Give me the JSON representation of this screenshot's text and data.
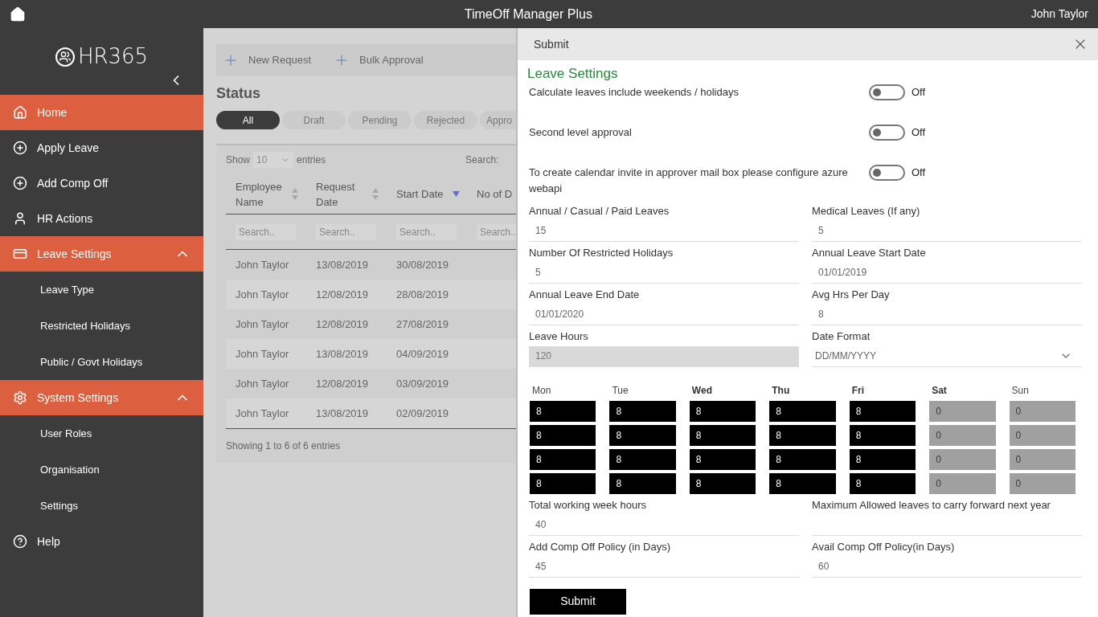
{
  "app_bar": {
    "title": "TimeOff Manager Plus",
    "user": "John Taylor"
  },
  "sidebar": {
    "logo": "HR365",
    "items": [
      {
        "kind": "link",
        "label": "Home",
        "selected": true
      },
      {
        "kind": "link",
        "label": "Apply Leave",
        "selected": false
      },
      {
        "kind": "link",
        "label": "Add Comp Off",
        "selected": false
      },
      {
        "kind": "link",
        "label": "HR Actions",
        "selected": false
      },
      {
        "kind": "group",
        "label": "Leave Settings",
        "expanded": true,
        "children": [
          {
            "label": "Leave Type"
          },
          {
            "label": "Restricted Holidays"
          },
          {
            "label": "Public / Govt Holidays"
          }
        ]
      },
      {
        "kind": "group",
        "label": "System Settings",
        "expanded": true,
        "children": [
          {
            "label": "User Roles"
          },
          {
            "label": "Organisation"
          },
          {
            "label": "Settings"
          }
        ]
      },
      {
        "kind": "link",
        "label": "Help",
        "selected": false
      }
    ]
  },
  "toolbar": [
    "New Request",
    "Bulk Approval"
  ],
  "status": {
    "title": "Status",
    "filters": [
      {
        "label": "All",
        "selected": true
      },
      {
        "label": "Draft",
        "selected": false
      },
      {
        "label": "Pending",
        "selected": false
      },
      {
        "label": "Rejected",
        "selected": false
      },
      {
        "label": "Appro",
        "selected": false
      }
    ]
  },
  "table": {
    "show_label": "Show",
    "page_size": "10",
    "entries_label": "entries",
    "search_label": "Search:",
    "columns": [
      {
        "label": "Employee Name",
        "sorted": false
      },
      {
        "label": "Request Date",
        "sorted": false
      },
      {
        "label": "Start Date",
        "sorted": true
      },
      {
        "label": "No of D"
      }
    ],
    "filter_placeholders": [
      "Search..",
      "Search..",
      "Search..",
      "Search.."
    ],
    "rows": [
      [
        "John Taylor",
        "13/08/2019",
        "30/08/2019"
      ],
      [
        "John Taylor",
        "12/08/2019",
        "28/08/2019"
      ],
      [
        "John Taylor",
        "12/08/2019",
        "27/08/2019"
      ],
      [
        "John Taylor",
        "13/08/2019",
        "04/09/2019"
      ],
      [
        "John Taylor",
        "12/08/2019",
        "03/09/2019"
      ],
      [
        "John Taylor",
        "13/08/2019",
        "02/09/2019"
      ]
    ],
    "footer": "Showing 1 to 6 of 6 entries"
  },
  "panel": {
    "header": "Submit",
    "title": "Leave Settings",
    "toggles": [
      {
        "label": "Calculate leaves include weekends / holidays",
        "on": false,
        "state_text": "Off"
      },
      {
        "label": "Second level approval",
        "on": false,
        "state_text": "Off"
      },
      {
        "label": "To create calendar invite in approver mail box please configure azure webapi",
        "on": false,
        "state_text": "Off"
      }
    ],
    "fields": [
      {
        "kind": "text",
        "label": "Annual / Casual / Paid Leaves",
        "value": "15"
      },
      {
        "kind": "text",
        "label": "Medical Leaves (If any)",
        "value": "5"
      },
      {
        "kind": "text",
        "label": "Number Of Restricted Holidays",
        "value": "5"
      },
      {
        "kind": "text",
        "label": "Annual Leave Start Date",
        "value": "01/01/2019"
      },
      {
        "kind": "text",
        "label": "Annual Leave End Date",
        "value": "01/01/2020"
      },
      {
        "kind": "text",
        "label": "Avg Hrs Per Day",
        "value": "8"
      },
      {
        "kind": "readonly",
        "label": "Leave Hours",
        "value": "120"
      },
      {
        "kind": "select",
        "label": "Date Format",
        "value": "DD/MM/YYYY"
      }
    ],
    "days": [
      {
        "label": "Mon",
        "bold": false,
        "disabled": false,
        "hours": [
          "8",
          "8",
          "8",
          "8"
        ]
      },
      {
        "label": "Tue",
        "bold": false,
        "disabled": false,
        "hours": [
          "8",
          "8",
          "8",
          "8"
        ]
      },
      {
        "label": "Wed",
        "bold": true,
        "disabled": false,
        "hours": [
          "8",
          "8",
          "8",
          "8"
        ]
      },
      {
        "label": "Thu",
        "bold": true,
        "disabled": false,
        "hours": [
          "8",
          "8",
          "8",
          "8"
        ]
      },
      {
        "label": "Fri",
        "bold": true,
        "disabled": false,
        "hours": [
          "8",
          "8",
          "8",
          "8"
        ]
      },
      {
        "label": "Sat",
        "bold": true,
        "disabled": true,
        "hours": [
          "0",
          "0",
          "0",
          "0"
        ]
      },
      {
        "label": "Sun",
        "bold": false,
        "disabled": true,
        "hours": [
          "0",
          "0",
          "0",
          "0"
        ]
      }
    ],
    "fields_after": [
      {
        "kind": "text",
        "label": "Total working week hours",
        "value": "40"
      },
      {
        "kind": "text",
        "label": "Maximum Allowed leaves to carry forward next year"
      },
      {
        "kind": "text",
        "label": "Add Comp Off Policy (in Days)",
        "value": "45"
      },
      {
        "kind": "text",
        "label": "Avail Comp Off Policy(in Days)",
        "value": "60"
      }
    ],
    "submit": "Submit"
  }
}
